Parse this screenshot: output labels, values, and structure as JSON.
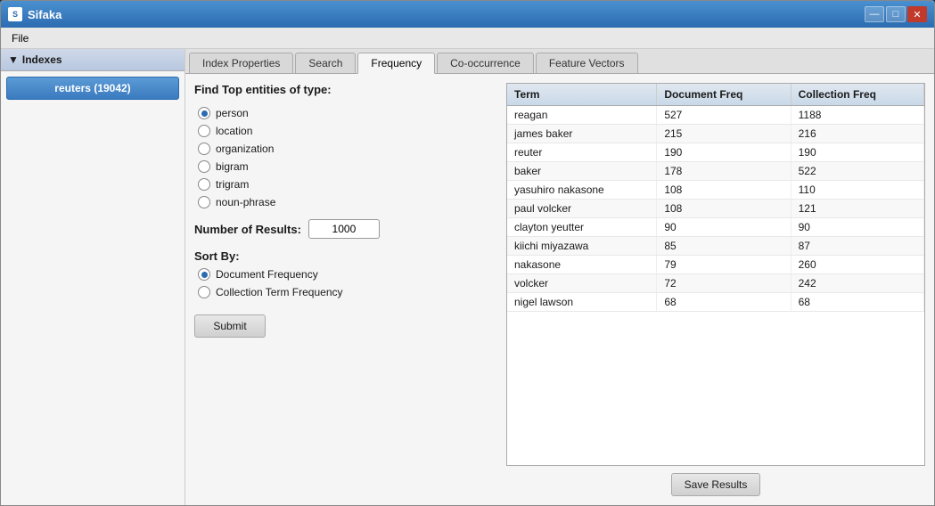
{
  "window": {
    "title": "Sifaka",
    "icon_label": "S"
  },
  "title_controls": {
    "minimize": "—",
    "restore": "□",
    "close": "✕"
  },
  "menu": {
    "file_label": "File"
  },
  "sidebar": {
    "header": "Indexes",
    "index_item": "reuters (19042)"
  },
  "tabs": [
    {
      "id": "index-properties",
      "label": "Index Properties"
    },
    {
      "id": "search",
      "label": "Search"
    },
    {
      "id": "frequency",
      "label": "Frequency",
      "active": true
    },
    {
      "id": "co-occurrence",
      "label": "Co-occurrence"
    },
    {
      "id": "feature-vectors",
      "label": "Feature Vectors"
    }
  ],
  "form": {
    "find_top_label": "Find Top entities of type:",
    "entity_types": [
      {
        "id": "person",
        "label": "person",
        "selected": true
      },
      {
        "id": "location",
        "label": "location",
        "selected": false
      },
      {
        "id": "organization",
        "label": "organization",
        "selected": false
      },
      {
        "id": "bigram",
        "label": "bigram",
        "selected": false
      },
      {
        "id": "trigram",
        "label": "trigram",
        "selected": false
      },
      {
        "id": "noun-phrase",
        "label": "noun-phrase",
        "selected": false
      }
    ],
    "num_results_label": "Number of Results:",
    "num_results_value": "1000",
    "sort_by_label": "Sort By:",
    "sort_options": [
      {
        "id": "doc-freq",
        "label": "Document Frequency",
        "selected": true
      },
      {
        "id": "coll-term-freq",
        "label": "Collection Term Frequency",
        "selected": false
      }
    ],
    "submit_label": "Submit"
  },
  "results": {
    "columns": [
      "Term",
      "Document Freq",
      "Collection Freq"
    ],
    "rows": [
      {
        "term": "reagan",
        "doc_freq": "527",
        "coll_freq": "1188"
      },
      {
        "term": "james baker",
        "doc_freq": "215",
        "coll_freq": "216"
      },
      {
        "term": "reuter",
        "doc_freq": "190",
        "coll_freq": "190"
      },
      {
        "term": "baker",
        "doc_freq": "178",
        "coll_freq": "522"
      },
      {
        "term": "yasuhiro nakasone",
        "doc_freq": "108",
        "coll_freq": "110"
      },
      {
        "term": "paul volcker",
        "doc_freq": "108",
        "coll_freq": "121"
      },
      {
        "term": "clayton yeutter",
        "doc_freq": "90",
        "coll_freq": "90"
      },
      {
        "term": "kiichi miyazawa",
        "doc_freq": "85",
        "coll_freq": "87"
      },
      {
        "term": "nakasone",
        "doc_freq": "79",
        "coll_freq": "260"
      },
      {
        "term": "volcker",
        "doc_freq": "72",
        "coll_freq": "242"
      },
      {
        "term": "nigel lawson",
        "doc_freq": "68",
        "coll_freq": "68"
      }
    ],
    "save_button_label": "Save Results"
  }
}
